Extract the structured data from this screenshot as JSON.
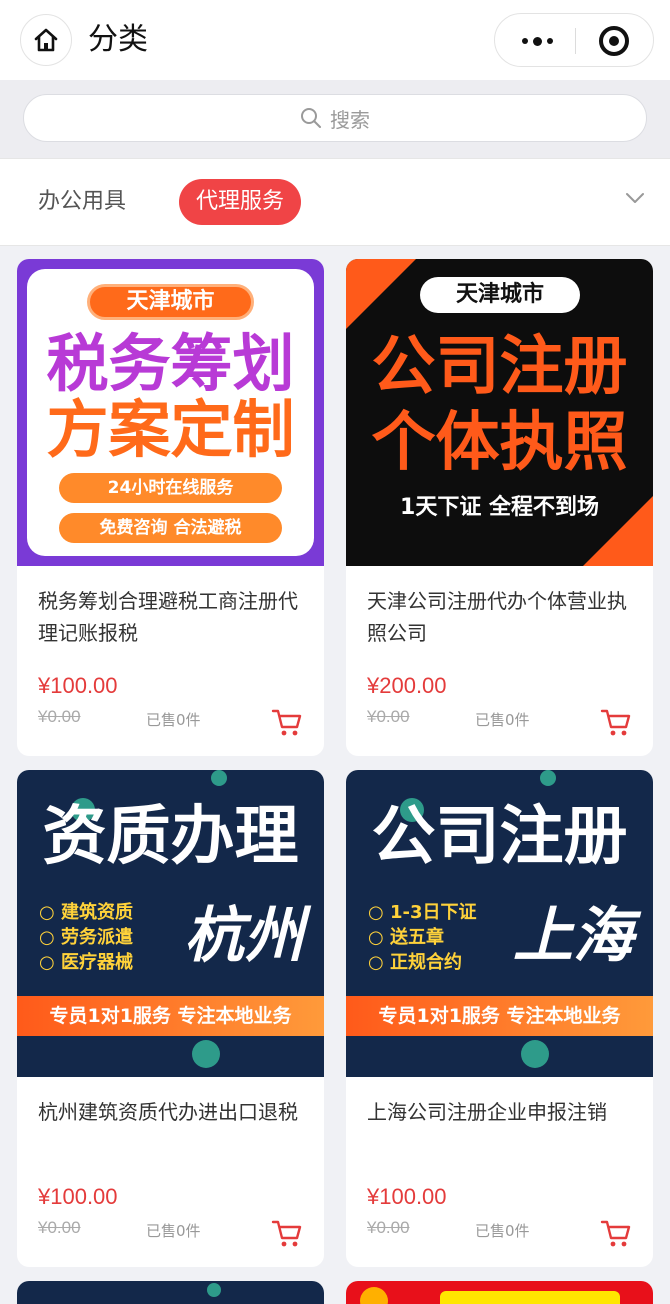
{
  "header": {
    "title": "分类"
  },
  "search": {
    "placeholder": "搜索"
  },
  "tabs": [
    {
      "label": "办公用具",
      "active": false
    },
    {
      "label": "代理服务",
      "active": true
    }
  ],
  "products": [
    {
      "title": "税务筹划合理避税工商注册代理记账报税",
      "price": "¥100.00",
      "original_price": "¥0.00",
      "sold": "已售0件",
      "poster": {
        "tag": "天津城市",
        "line1": "税务筹划",
        "line2": "方案定制",
        "pill1": "24小时在线服务",
        "pill2": "免费咨询 合法避税"
      }
    },
    {
      "title": "天津公司注册代办个体营业执照公司",
      "price": "¥200.00",
      "original_price": "¥0.00",
      "sold": "已售0件",
      "poster": {
        "tag": "天津城市",
        "line1": "公司注册",
        "line2": "个体执照",
        "footer": "1天下证 全程不到场"
      }
    },
    {
      "title": "杭州建筑资质代办进出口退税",
      "price": "¥100.00",
      "original_price": "¥0.00",
      "sold": "已售0件",
      "poster": {
        "headline": "资质办理",
        "bullets": [
          "建筑资质",
          "劳务派遣",
          "医疗器械"
        ],
        "city": "杭州",
        "banner": "专员1对1服务 专注本地业务"
      }
    },
    {
      "title": "上海公司注册企业申报注销",
      "price": "¥100.00",
      "original_price": "¥0.00",
      "sold": "已售0件",
      "poster": {
        "headline": "公司注册",
        "bullets": [
          "1-3日下证",
          "送五章",
          "正规合约"
        ],
        "city": "上海",
        "banner": "专员1对1服务 专注本地业务"
      }
    }
  ],
  "colors": {
    "accent": "#f04446",
    "price": "#e43b3b",
    "navy": "#13284a",
    "orange": "#ff6a1a"
  },
  "icons": [
    "home-icon",
    "more-dots-icon",
    "target-icon",
    "search-icon",
    "chevron-down-icon",
    "cart-icon"
  ]
}
